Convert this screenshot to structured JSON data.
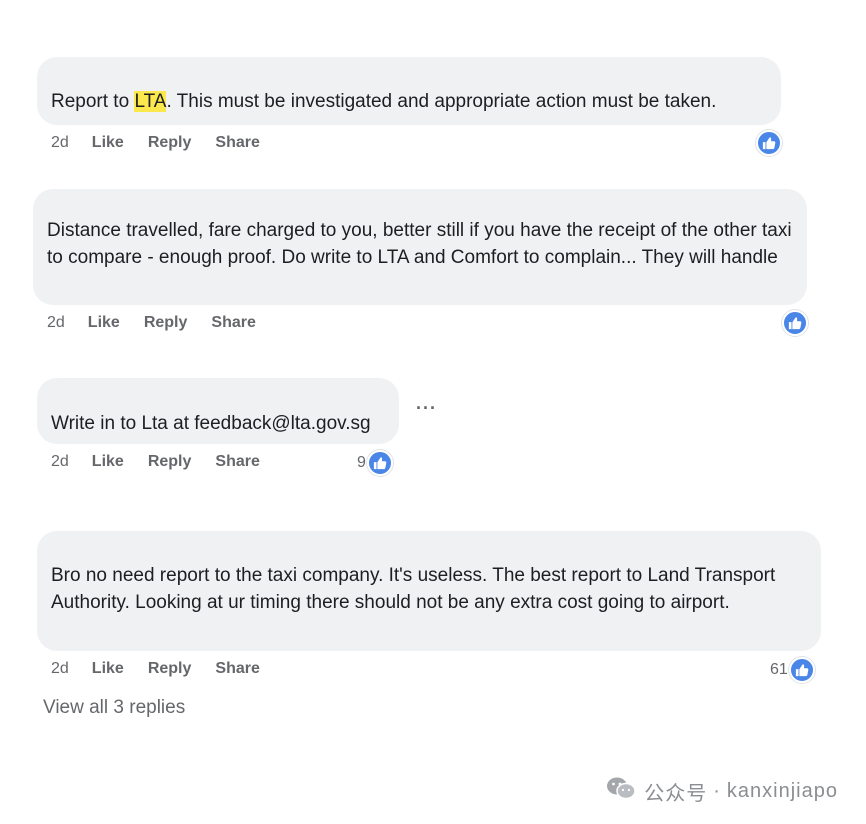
{
  "comments": [
    {
      "text_before": "Report to ",
      "highlight": "LTA",
      "text_after": ". This must be investigated and appropriate action must be taken.",
      "time": "2d",
      "like": "Like",
      "reply": "Reply",
      "share": "Share",
      "reaction_count": ""
    },
    {
      "text": "Distance travelled, fare charged to you, better still if you have the receipt of the other taxi to compare - enough proof. Do write to LTA and Comfort to complain... They will handle",
      "time": "2d",
      "like": "Like",
      "reply": "Reply",
      "share": "Share",
      "reaction_count": ""
    },
    {
      "text": "Write in to Lta at feedback@lta.gov.sg",
      "time": "2d",
      "like": "Like",
      "reply": "Reply",
      "share": "Share",
      "reaction_count": "9",
      "more": "···"
    },
    {
      "text": "Bro no need report to the taxi company. It's useless. The best report to Land Transport Authority. Looking at ur timing there should not be any extra cost going to airport.",
      "time": "2d",
      "like": "Like",
      "reply": "Reply",
      "share": "Share",
      "reaction_count": "61"
    }
  ],
  "view_all_replies": "View all 3 replies",
  "watermark": {
    "label": "公众号",
    "separator": "·",
    "account": "kanxinjiapo"
  },
  "colors": {
    "bubble": "#f0f1f3",
    "highlight": "#fbe84c",
    "like_blue": "#4a85e8",
    "meta_gray": "#65676b"
  },
  "icons": [
    "thumbs-up-icon",
    "more-options-icon",
    "wechat-icon"
  ]
}
